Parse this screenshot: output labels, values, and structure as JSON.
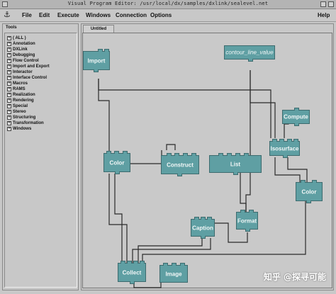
{
  "window": {
    "title": "Visual Program Editor: /usr/local/dx/samples/dxlink/sealevel.net"
  },
  "menubar": {
    "items": [
      {
        "label": "File"
      },
      {
        "label": "Edit"
      },
      {
        "label": "Execute"
      },
      {
        "label": "Windows"
      },
      {
        "label": "Connection"
      },
      {
        "label": "Options"
      }
    ],
    "help": {
      "label": "Help"
    }
  },
  "tools_panel": {
    "title": "Tools",
    "items": [
      {
        "label": "( ALL )"
      },
      {
        "label": "Annotation"
      },
      {
        "label": "DXLink"
      },
      {
        "label": "Debugging"
      },
      {
        "label": "Flow Control"
      },
      {
        "label": "Import and Export"
      },
      {
        "label": "Interactor"
      },
      {
        "label": "Interface Control"
      },
      {
        "label": "Macros"
      },
      {
        "label": "RAMS"
      },
      {
        "label": "Realization"
      },
      {
        "label": "Rendering"
      },
      {
        "label": "Special"
      },
      {
        "label": "Stereo"
      },
      {
        "label": "Structuring"
      },
      {
        "label": "Transformation"
      },
      {
        "label": "Windows"
      }
    ]
  },
  "canvas": {
    "tab_label": "Untitled",
    "nodes": {
      "import": "Import",
      "contour_line_value": "contour_line_value",
      "compute": "Compute",
      "isosurface": "Isosurface",
      "color_1": "Color",
      "construct": "Construct",
      "list": "List",
      "color_2": "Color",
      "format": "Format",
      "caption": "Caption",
      "collect": "Collect",
      "image": "Image"
    }
  },
  "watermark": "知乎 @探寻可能",
  "colors": {
    "module": "#5f9fa3",
    "canvas": "#c9c9c9",
    "chrome": "#c8c8c8"
  }
}
